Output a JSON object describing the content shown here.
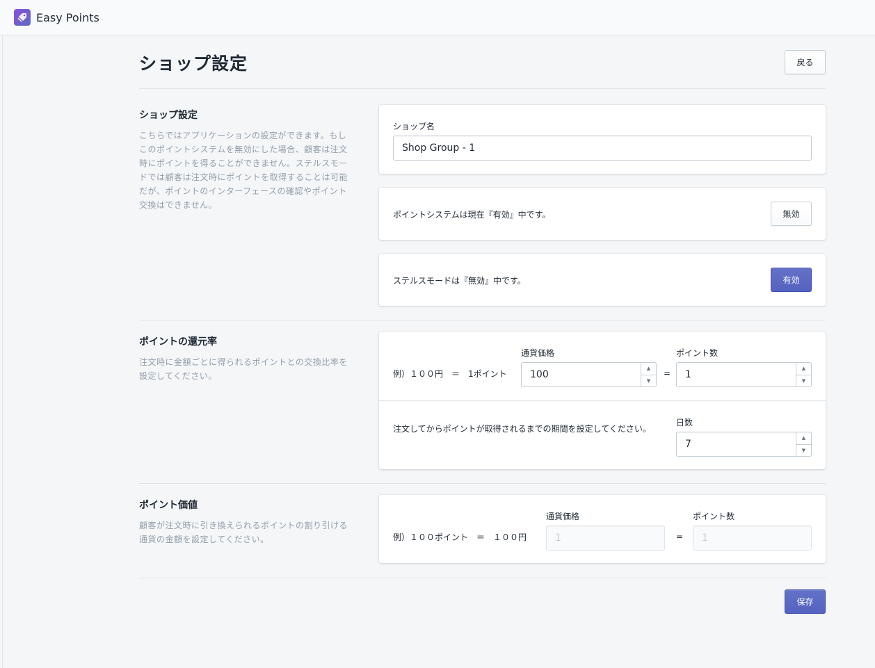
{
  "app": {
    "name": "Easy Points",
    "logo_icon": "tag-icon"
  },
  "header": {
    "title": "ショップ設定",
    "back_label": "戻る"
  },
  "shop_section": {
    "title": "ショップ設定",
    "description": "こちらではアプリケーションの設定ができます。もしこのポイントシステムを無効にした場合、顧客は注文時にポイントを得ることができません。ステルスモードでは顧客は注文時にポイントを取得することは可能だが、ポイントのインターフェースの確認やポイント交換はできません。",
    "shop_name_label": "ショップ名",
    "shop_name_value": "Shop Group - 1",
    "point_system_status": "ポイントシステムは現在『有効』中です。",
    "point_system_button": "無効",
    "stealth_status": "ステルスモードは『無効』中です。",
    "stealth_button": "有効"
  },
  "return_rate_section": {
    "title": "ポイントの還元率",
    "description": "注文時に金額ごとに得られるポイントとの交換比率を設定してください。",
    "example": "例）１００円　＝　1ポイント",
    "currency_label": "通貨価格",
    "currency_value": "100",
    "points_label": "ポイント数",
    "points_value": "1",
    "equals": "=",
    "period_text": "注文してからポイントが取得されるまでの期間を設定してください。",
    "days_label": "日数",
    "days_value": "7"
  },
  "point_value_section": {
    "title": "ポイント価値",
    "description": "顧客が注文時に引き換えられるポイントの割り引ける通貨の金額を設定してください。",
    "example": "例）１００ポイント　＝　１００円",
    "currency_label": "通貨価格",
    "currency_placeholder": "1",
    "points_label": "ポイント数",
    "points_placeholder": "1",
    "equals": "="
  },
  "footer": {
    "save_label": "保存"
  },
  "colors": {
    "primary": "#5c6ac4",
    "background": "#f4f6f8",
    "muted_text": "#919eab"
  }
}
